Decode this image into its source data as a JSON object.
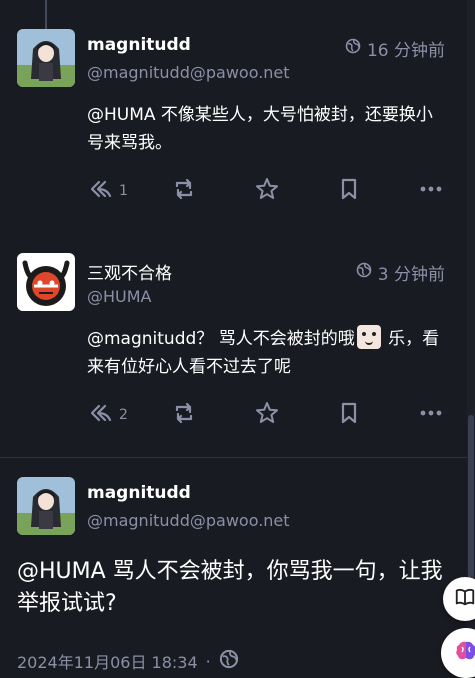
{
  "statuses": [
    {
      "display_name": "magnitudd",
      "acct": "@magnitudd@pawoo.net",
      "time": "16 分钟前",
      "content": "@HUMA 不像某些人，大号怕被封，还要换小号来骂我。",
      "reply_count": "1"
    },
    {
      "display_name": "三观不合格",
      "acct": "@HUMA",
      "time": "3 分钟前",
      "content_before": "@magnitudd？ 骂人不会被封的哦",
      "content_after": " 乐，看来有位好心人看不过去了呢",
      "reply_count": "2"
    }
  ],
  "focused": {
    "display_name": "magnitudd",
    "acct": "@magnitudd@pawoo.net",
    "content": "@HUMA 骂人不会被封，你骂我一句，让我举报试试?",
    "date": "2024年11月06日 18:34",
    "separator": "·"
  },
  "icons": {
    "visibility": "globe-icon",
    "reply": "reply-all-icon",
    "boost": "retweet-icon",
    "favourite": "star-icon",
    "bookmark": "bookmark-icon",
    "more": "ellipsis-icon",
    "fab_top": "book-icon",
    "fab_bottom": "brain-icon"
  },
  "colors": {
    "background": "#191b22",
    "muted": "#8c8fa6",
    "text": "#ffffff"
  }
}
